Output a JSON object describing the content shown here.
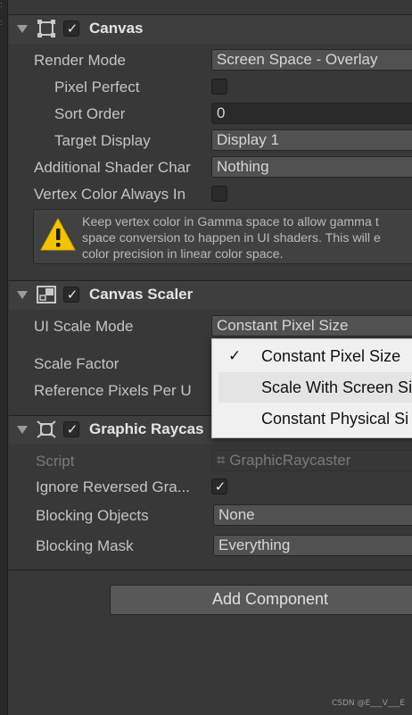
{
  "canvas": {
    "title": "Canvas",
    "enabled": true,
    "render_mode": {
      "label": "Render Mode",
      "value": "Screen Space - Overlay"
    },
    "pixel_perfect": {
      "label": "Pixel Perfect",
      "checked": false
    },
    "sort_order": {
      "label": "Sort Order",
      "value": "0"
    },
    "target_display": {
      "label": "Target Display",
      "value": "Display 1"
    },
    "additional_shader": {
      "label": "Additional Shader Char",
      "value": "Nothing"
    },
    "vertex_color": {
      "label": "Vertex Color Always In",
      "checked": false
    },
    "help": {
      "icon": "warning-icon",
      "lines": [
        "Keep vertex color in Gamma space to allow gamma t",
        "space conversion to happen in UI shaders. This will e",
        "color precision in linear color space."
      ]
    }
  },
  "canvas_scaler": {
    "title": "Canvas Scaler",
    "enabled": true,
    "ui_scale_mode": {
      "label": "UI Scale Mode",
      "value": "Constant Pixel Size"
    },
    "scale_factor": {
      "label": "Scale Factor"
    },
    "reference_pixels": {
      "label": "Reference Pixels Per U"
    },
    "popup": {
      "options": [
        "Constant Pixel Size",
        "Scale With Screen Si",
        "Constant Physical Si"
      ],
      "selected_index": 0,
      "hover_index": 1
    }
  },
  "graphic_raycaster": {
    "title": "Graphic Raycas",
    "enabled": true,
    "script": {
      "label": "Script",
      "value": "GraphicRaycaster"
    },
    "ignore_reversed": {
      "label": "Ignore Reversed Gra...",
      "checked": true
    },
    "blocking_objects": {
      "label": "Blocking Objects",
      "value": "None"
    },
    "blocking_mask": {
      "label": "Blocking Mask",
      "value": "Everything"
    }
  },
  "add_component": {
    "label": "Add Component"
  },
  "watermark": "CSDN @E___V___E",
  "icons": {
    "canvas": "rect-transform-icon",
    "canvas_scaler": "canvas-scaler-icon",
    "raycaster": "raycaster-icon",
    "check": "check-icon",
    "fold": "foldout-arrow-icon"
  },
  "colors": {
    "background": "#383838",
    "header": "#3e3e3e",
    "warning": "#f5c400",
    "popup_bg": "#f0f0f0"
  }
}
